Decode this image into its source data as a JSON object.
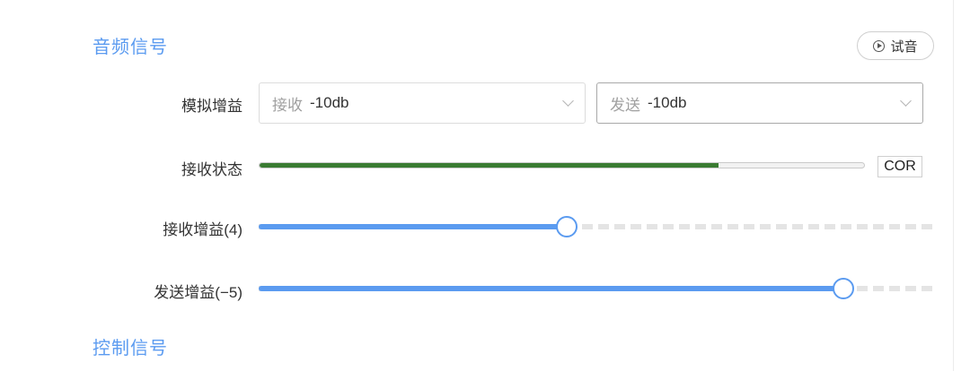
{
  "audio_section": {
    "title": "音频信号",
    "audition_button_label": "试音",
    "analog_gain": {
      "label": "模拟增益",
      "receive": {
        "prefix": "接收",
        "value": "-10db"
      },
      "send": {
        "prefix": "发送",
        "value": "-10db"
      }
    },
    "receive_status": {
      "label": "接收状态",
      "level_fraction": 0.76,
      "badge": "COR"
    },
    "receive_gain": {
      "label": "接收增益(4)",
      "fraction": 0.455
    },
    "send_gain": {
      "label": "发送增益(−5)",
      "fraction": 0.865
    }
  },
  "control_section": {
    "title": "控制信号"
  },
  "colors": {
    "accent": "#5b9bf0",
    "status_green": "#3a7b32"
  },
  "icons": {
    "audition": "play-circle-icon",
    "dropdown": "chevron-down-icon"
  }
}
